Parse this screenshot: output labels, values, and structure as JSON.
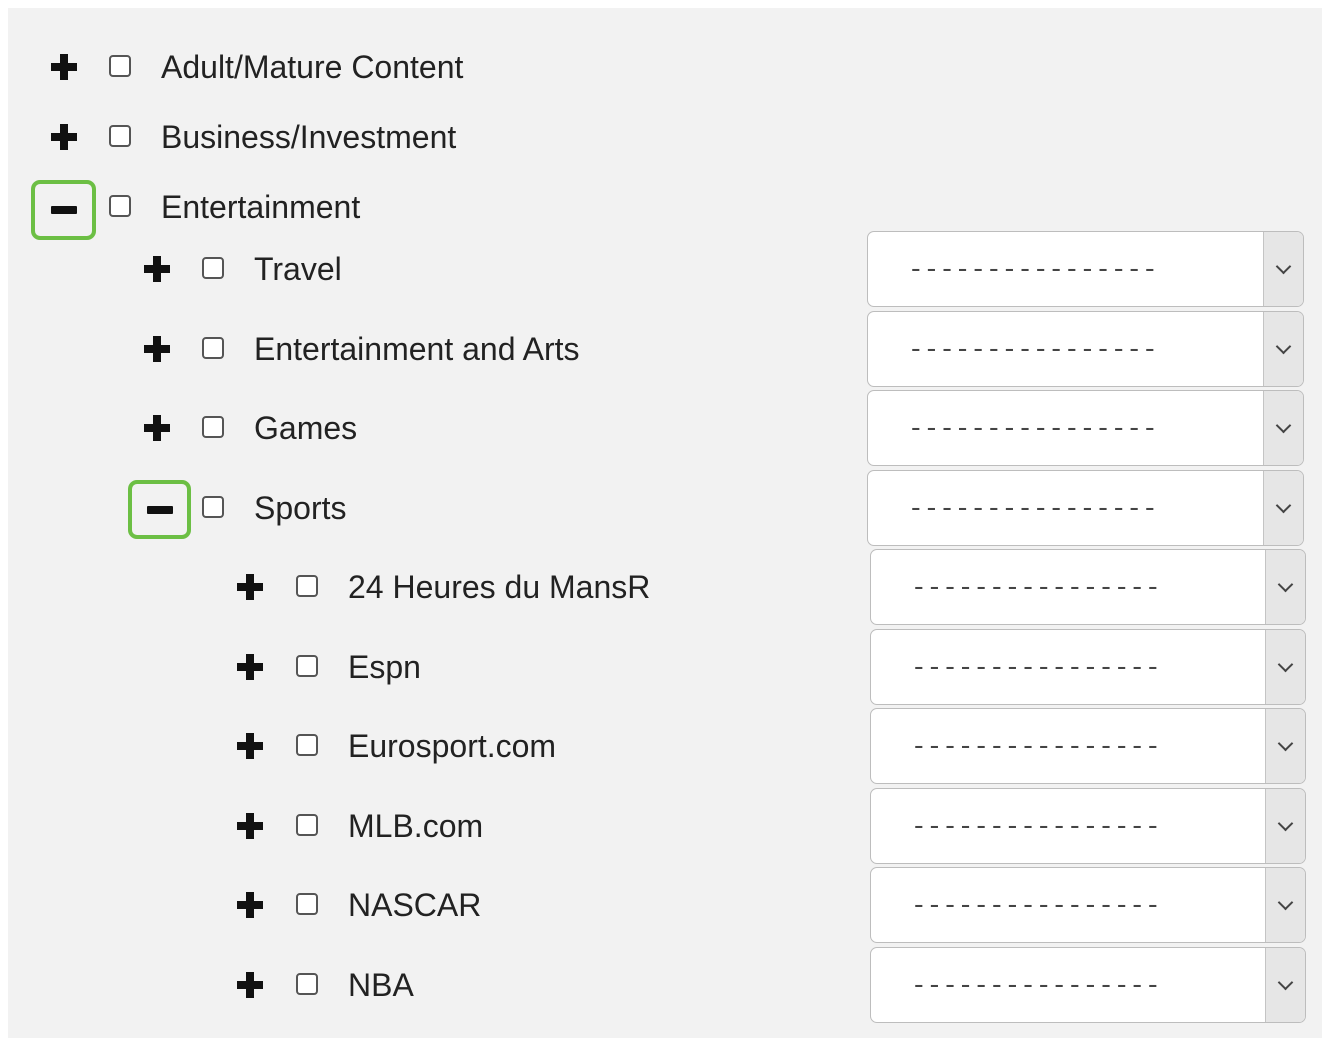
{
  "tree": {
    "top_level": [
      {
        "label": "Adult/Mature Content",
        "toggle": "plus-icon",
        "checked": false
      },
      {
        "label": "Business/Investment",
        "toggle": "plus-icon",
        "checked": false
      },
      {
        "label": "Entertainment",
        "toggle": "minus-icon",
        "checked": false,
        "highlighted": true
      }
    ],
    "entertainment_children": [
      {
        "label": "Travel",
        "toggle": "plus-icon",
        "select_value": "----------------"
      },
      {
        "label": "Entertainment and Arts",
        "toggle": "plus-icon",
        "select_value": "----------------"
      },
      {
        "label": "Games",
        "toggle": "plus-icon",
        "select_value": "----------------"
      },
      {
        "label": "Sports",
        "toggle": "minus-icon",
        "highlighted": true,
        "select_value": "----------------"
      }
    ],
    "sports_children": [
      {
        "label": "24 Heures du MansR",
        "toggle": "plus-icon",
        "select_value": "----------------"
      },
      {
        "label": "Espn",
        "toggle": "plus-icon",
        "select_value": "----------------"
      },
      {
        "label": "Eurosport.com",
        "toggle": "plus-icon",
        "select_value": "----------------"
      },
      {
        "label": "MLB.com",
        "toggle": "plus-icon",
        "select_value": "----------------"
      },
      {
        "label": "NASCAR",
        "toggle": "plus-icon",
        "select_value": "----------------"
      },
      {
        "label": "NBA",
        "toggle": "plus-icon",
        "select_value": "----------------"
      }
    ]
  },
  "colors": {
    "highlight": "#6cbf44",
    "panel_background": "#f2f2f2"
  }
}
